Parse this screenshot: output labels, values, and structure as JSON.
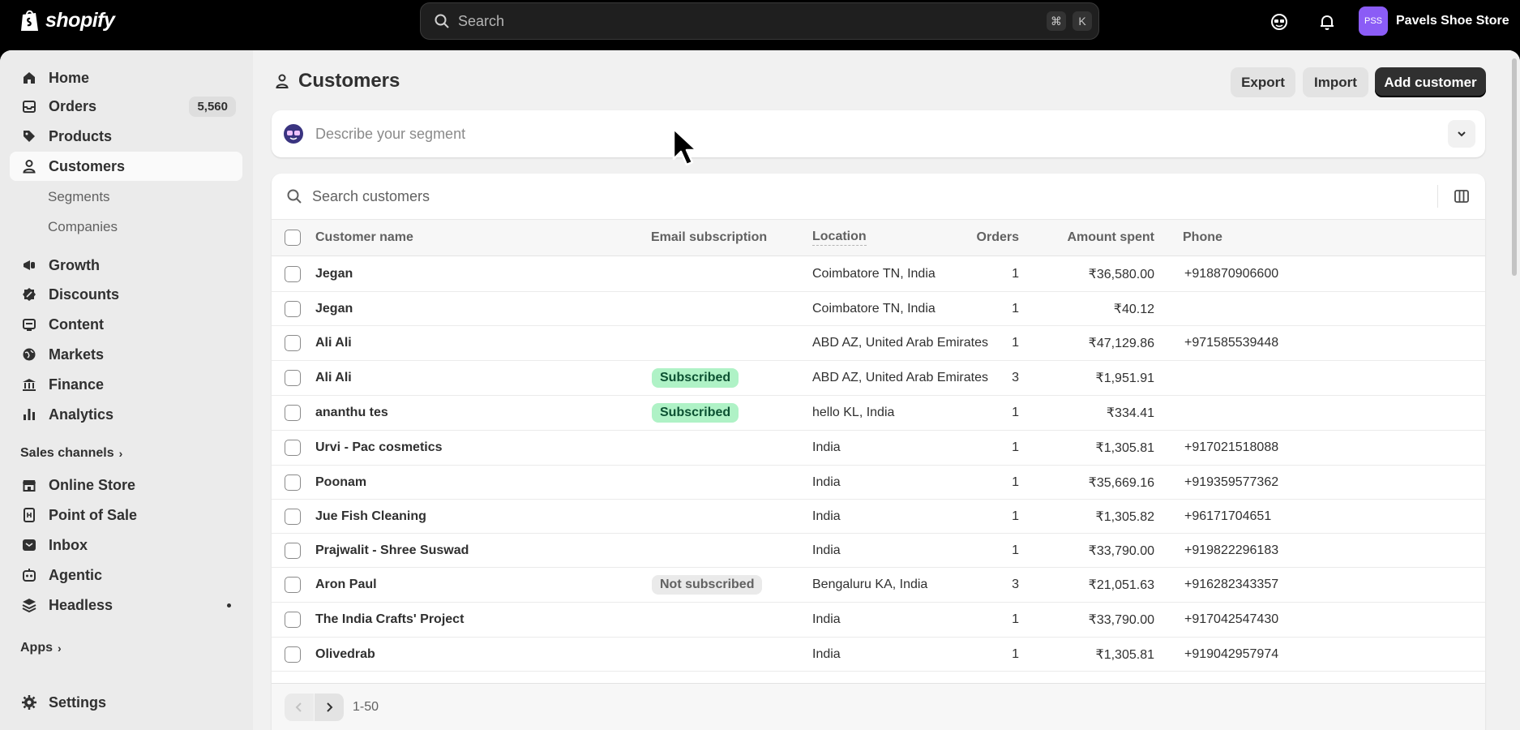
{
  "topbar": {
    "brand": "shopify",
    "search_placeholder": "Search",
    "shortcut_cmd": "⌘",
    "shortcut_key": "K",
    "store_initials": "PSS",
    "store_name": "Pavels Shoe Store"
  },
  "sidebar": {
    "items": [
      {
        "label": "Home",
        "icon": "home-icon"
      },
      {
        "label": "Orders",
        "icon": "inbox-icon",
        "count": "5,560"
      },
      {
        "label": "Products",
        "icon": "tag-icon"
      },
      {
        "label": "Customers",
        "icon": "person-icon",
        "active": true
      },
      {
        "label": "Segments"
      },
      {
        "label": "Companies"
      },
      {
        "label": "Growth",
        "icon": "megaphone-icon"
      },
      {
        "label": "Discounts",
        "icon": "discount-icon"
      },
      {
        "label": "Content",
        "icon": "content-icon"
      },
      {
        "label": "Markets",
        "icon": "globe-icon"
      },
      {
        "label": "Finance",
        "icon": "bank-icon"
      },
      {
        "label": "Analytics",
        "icon": "chart-icon"
      }
    ],
    "sales_channels_heading": "Sales channels",
    "channels": [
      {
        "label": "Online Store",
        "icon": "store-icon"
      },
      {
        "label": "Point of Sale",
        "icon": "pos-icon"
      },
      {
        "label": "Inbox",
        "icon": "inbox-app-icon"
      },
      {
        "label": "Agentic",
        "icon": "agentic-icon"
      },
      {
        "label": "Headless",
        "icon": "headless-icon"
      }
    ],
    "apps_heading": "Apps",
    "settings_label": "Settings"
  },
  "page": {
    "title": "Customers",
    "export_label": "Export",
    "import_label": "Import",
    "add_label": "Add customer",
    "segment_placeholder": "Describe your segment",
    "search_placeholder": "Search customers"
  },
  "table": {
    "headers": {
      "name": "Customer name",
      "email": "Email subscription",
      "location": "Location",
      "orders": "Orders",
      "amount": "Amount spent",
      "phone": "Phone"
    },
    "rows": [
      {
        "name": "Jegan",
        "email": "",
        "location": "Coimbatore TN, India",
        "orders": "1",
        "amount": "₹36,580.00",
        "phone": "+918870906600"
      },
      {
        "name": "Jegan",
        "email": "",
        "location": "Coimbatore TN, India",
        "orders": "1",
        "amount": "₹40.12",
        "phone": ""
      },
      {
        "name": "Ali Ali",
        "email": "",
        "location": "ABD AZ, United Arab Emirates",
        "orders": "1",
        "amount": "₹47,129.86",
        "phone": "+971585539448"
      },
      {
        "name": "Ali Ali",
        "email": "Subscribed",
        "location": "ABD AZ, United Arab Emirates",
        "orders": "3",
        "amount": "₹1,951.91",
        "phone": ""
      },
      {
        "name": "ananthu tes",
        "email": "Subscribed",
        "location": "hello KL, India",
        "orders": "1",
        "amount": "₹334.41",
        "phone": ""
      },
      {
        "name": "Urvi - Pac cosmetics",
        "email": "",
        "location": "India",
        "orders": "1",
        "amount": "₹1,305.81",
        "phone": "+917021518088"
      },
      {
        "name": "Poonam",
        "email": "",
        "location": "India",
        "orders": "1",
        "amount": "₹35,669.16",
        "phone": "+919359577362"
      },
      {
        "name": "Jue Fish Cleaning",
        "email": "",
        "location": "India",
        "orders": "1",
        "amount": "₹1,305.82",
        "phone": "+96171704651"
      },
      {
        "name": "Prajwalit - Shree Suswad",
        "email": "",
        "location": "India",
        "orders": "1",
        "amount": "₹33,790.00",
        "phone": "+919822296183"
      },
      {
        "name": "Aron Paul",
        "email": "Not subscribed",
        "location": "Bengaluru KA, India",
        "orders": "3",
        "amount": "₹21,051.63",
        "phone": "+916282343357"
      },
      {
        "name": "The India Crafts' Project",
        "email": "",
        "location": "India",
        "orders": "1",
        "amount": "₹33,790.00",
        "phone": "+917042547430"
      },
      {
        "name": "Olivedrab",
        "email": "",
        "location": "India",
        "orders": "1",
        "amount": "₹1,305.81",
        "phone": "+919042957974"
      }
    ],
    "pagination": "1-50"
  },
  "colors": {
    "subscribed_bg": "#aff2c6",
    "subscribed_fg": "#0c5132",
    "primary": "#303030",
    "avatar": "#8b5cf6"
  }
}
